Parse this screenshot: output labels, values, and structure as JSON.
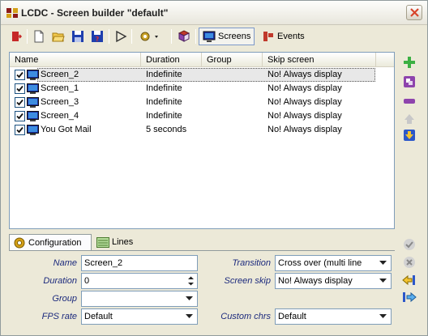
{
  "window": {
    "title": "LCDC - Screen builder \"default\""
  },
  "toolbar": {
    "tab_screens": "Screens",
    "tab_events": "Events"
  },
  "list": {
    "columns": [
      "Name",
      "Duration",
      "Group",
      "Skip screen"
    ],
    "rows": [
      {
        "name": "Screen_2",
        "duration": "Indefinite",
        "group": "",
        "skip": "No! Always display",
        "checked": true,
        "selected": true
      },
      {
        "name": "Screen_1",
        "duration": "Indefinite",
        "group": "",
        "skip": "No! Always display",
        "checked": true,
        "selected": false
      },
      {
        "name": "Screen_3",
        "duration": "Indefinite",
        "group": "",
        "skip": "No! Always display",
        "checked": true,
        "selected": false
      },
      {
        "name": "Screen_4",
        "duration": "Indefinite",
        "group": "",
        "skip": "No! Always display",
        "checked": true,
        "selected": false
      },
      {
        "name": "You Got Mail",
        "duration": "5 seconds",
        "group": "",
        "skip": "No! Always display",
        "checked": true,
        "selected": false
      }
    ]
  },
  "tabs": {
    "configuration": "Configuration",
    "lines": "Lines"
  },
  "form": {
    "name_label": "Name",
    "name_value": "Screen_2",
    "duration_label": "Duration",
    "duration_value": "0",
    "group_label": "Group",
    "group_value": "",
    "fps_label": "FPS rate",
    "fps_value": "Default",
    "transition_label": "Transition",
    "transition_value": "Cross over (multi line",
    "screen_skip_label": "Screen skip",
    "screen_skip_value": "No! Always display",
    "custom_chrs_label": "Custom chrs",
    "custom_chrs_value": "Default"
  },
  "colors": {
    "accent_blue": "#1c2a7d",
    "add_green": "#3cb043",
    "remove_red": "#c43a2e",
    "save_blue": "#1f3fae"
  },
  "icons": [
    "app-icon",
    "close-icon",
    "exit-icon",
    "new-icon",
    "open-icon",
    "save-icon",
    "save-as-icon",
    "run-icon",
    "settings-icon",
    "book-icon",
    "monitor-icon",
    "events-icon",
    "add-icon",
    "edit-icon",
    "remove-icon",
    "move-up-icon",
    "move-down-icon",
    "apply-icon",
    "cancel-icon",
    "import-icon",
    "export-icon"
  ]
}
